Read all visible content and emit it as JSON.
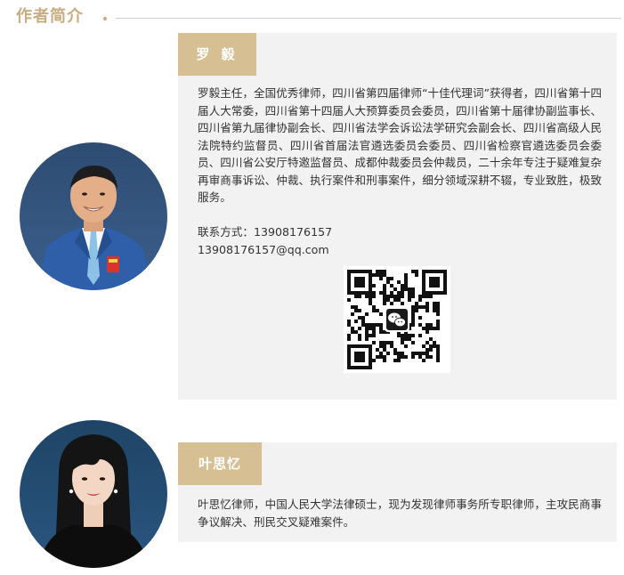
{
  "section": {
    "title": "作者简介"
  },
  "authors": [
    {
      "name": "罗 毅",
      "bio": "罗毅主任，全国优秀律师，四川省第四届律师“十佳代理词”获得者，四川省第十四届人大常委，四川省第十四届人大预算委员会委员，四川省第十届律协副监事长、四川省第九届律协副会长、四川省法学会诉讼法学研究会副会长、四川省高级人民法院特约监督员、四川省首届法官遴选委员会委员、四川省检察官遴选委员会委员、四川省公安厅特邀监督员、成都仲裁委员会仲裁员，二十余年专注于疑难复杂再审商事诉讼、仲裁、执行案件和刑事案件，细分领域深耕不辍，专业致胜，极致服务。",
      "contact_line": "联系方式：13908176157",
      "email": "13908176157@qq.com"
    },
    {
      "name": "叶思忆",
      "bio": "叶思忆律师，中国人民大学法律硕士，现为发现律师事务所专职律师，主攻民商事争议解决、刑民交叉疑难案件。"
    }
  ],
  "colors": {
    "accent": "#c8ad7f",
    "tab": "#d6c093",
    "card": "#f2f2f2",
    "text": "#333333"
  }
}
